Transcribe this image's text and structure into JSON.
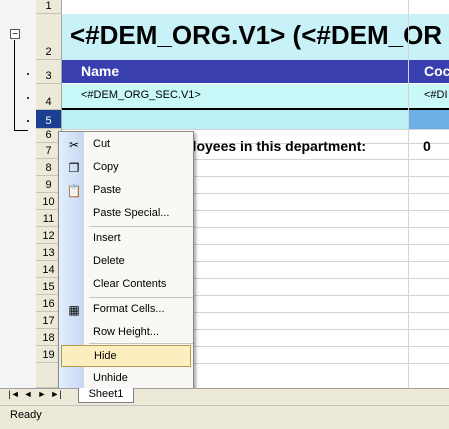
{
  "rows": [
    "1",
    "2",
    "3",
    "4",
    "5",
    "6",
    "7",
    "8",
    "9",
    "10",
    "11",
    "12",
    "13",
    "14",
    "15",
    "16",
    "17",
    "18",
    "19"
  ],
  "outline": {
    "collapse_symbol": "−"
  },
  "sheet": {
    "title": "<#DEM_ORG.V1> (<#DEM_OR",
    "header": {
      "name": "Name",
      "code": "Coc"
    },
    "data_row": {
      "name": "<#DEM_ORG_SEC.V1>",
      "code": "<#DI"
    },
    "employees_label": "ployees in this department:",
    "employees_value": "0"
  },
  "context_menu": {
    "items": [
      {
        "label": "Cut",
        "icon": "scissors-icon",
        "glyph": "✂"
      },
      {
        "label": "Copy",
        "icon": "copy-icon",
        "glyph": "❐"
      },
      {
        "label": "Paste",
        "icon": "paste-icon",
        "glyph": "📋"
      },
      {
        "label": "Paste Special...",
        "icon": "",
        "glyph": ""
      },
      {
        "label": "Insert",
        "icon": "",
        "glyph": ""
      },
      {
        "label": "Delete",
        "icon": "",
        "glyph": ""
      },
      {
        "label": "Clear Contents",
        "icon": "",
        "glyph": ""
      },
      {
        "label": "Format Cells...",
        "icon": "format-cells-icon",
        "glyph": "▦"
      },
      {
        "label": "Row Height...",
        "icon": "",
        "glyph": ""
      },
      {
        "label": "Hide",
        "icon": "",
        "glyph": ""
      },
      {
        "label": "Unhide",
        "icon": "",
        "glyph": ""
      }
    ],
    "highlighted": "Hide"
  },
  "tabs": {
    "nav": [
      "|◄",
      "◄",
      "►",
      "►|"
    ],
    "sheet_name": "Sheet1"
  },
  "status": {
    "text": "Ready"
  },
  "colors": {
    "title_band": "#c9f2f8",
    "header_band": "#3a3faf",
    "selected_row_header": "#1b3f91",
    "menu_highlight": "#fdeec0"
  }
}
